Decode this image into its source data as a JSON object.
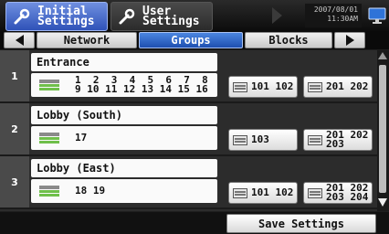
{
  "header": {
    "tab_initial": "Initial\nSettings",
    "tab_user": "User\nSettings",
    "datetime": "2007/08/01\n11:30AM"
  },
  "tabs": {
    "items": [
      "Network",
      "Groups",
      "Blocks"
    ],
    "active": "Groups"
  },
  "groups": [
    {
      "num": "1",
      "name": "Entrance",
      "addresses": "1  2  3  4  5  6  7  8\n9 10 11 12 13 14 15 16",
      "button_a": "101 102",
      "button_b": "201 202"
    },
    {
      "num": "2",
      "name": "Lobby (South)",
      "addresses": "17",
      "button_a": "103",
      "button_b": "201 202\n203"
    },
    {
      "num": "3",
      "name": "Lobby (East)",
      "addresses": "18 19",
      "button_a": "101 102",
      "button_b": "201 202\n203 204"
    }
  ],
  "footer": {
    "save_label": "Save Settings"
  },
  "colors": {
    "accent": "#2f5fc8",
    "unit_green": "#6fbf4a"
  }
}
